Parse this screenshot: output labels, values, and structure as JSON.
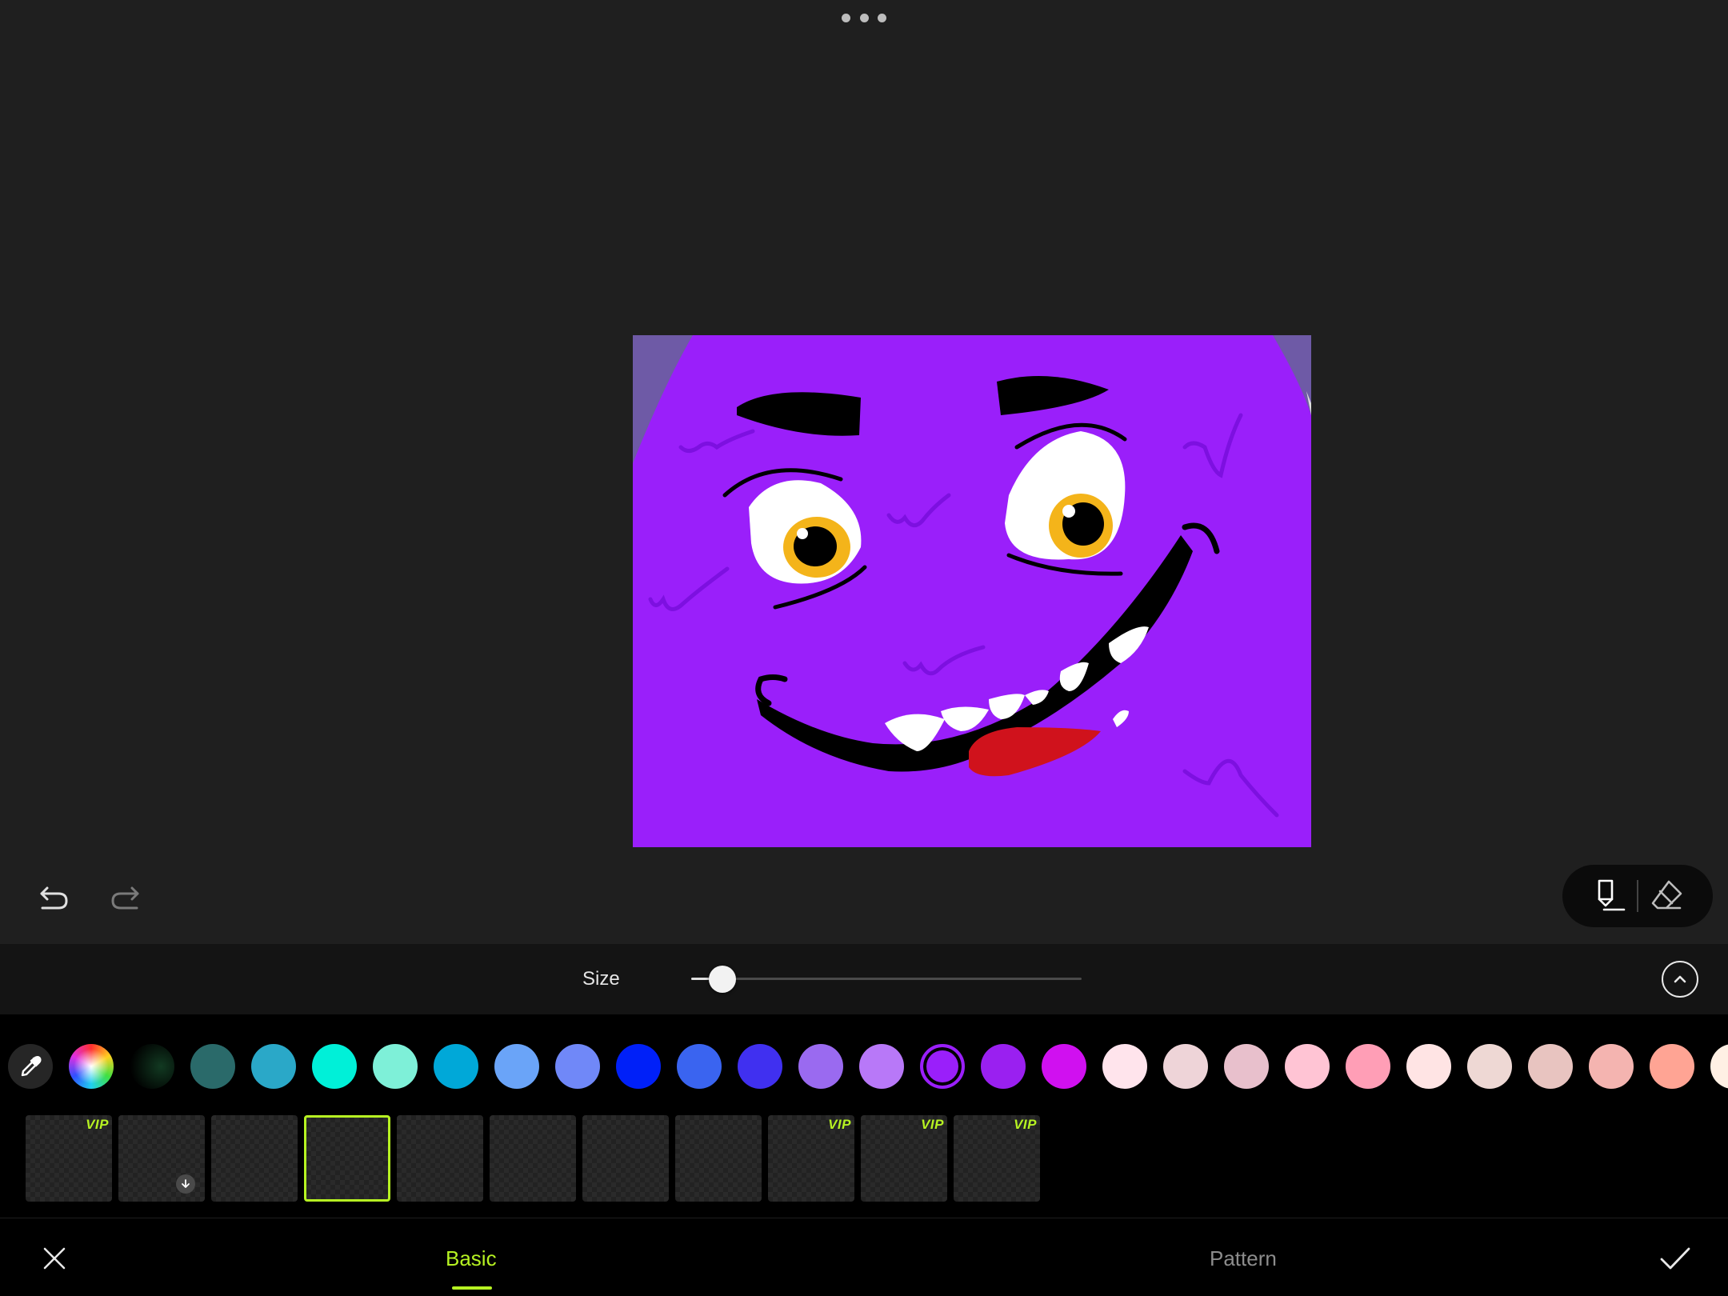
{
  "toolbar": {
    "more_icon": "more-horizontal-icon",
    "undo_icon": "undo-icon",
    "redo_icon": "redo-icon",
    "brush_icon": "brush-icon",
    "eraser_icon": "eraser-icon"
  },
  "size": {
    "label": "Size",
    "value_fraction": 0.08,
    "expand_icon": "chevron-up-icon"
  },
  "palette": {
    "eyedropper_icon": "eyedropper-icon",
    "selected_color": "#9a1ffa",
    "colors": [
      "conic-rainbow",
      "#0a2a1a",
      "#2a6a6a",
      "#2aa8c8",
      "#00f0d8",
      "#7ef0d8",
      "#00a8d8",
      "#6aa4f8",
      "#7088f8",
      "#0020f8",
      "#3a64f0",
      "#4030f0",
      "#9a6af0",
      "#b878f8",
      "#9a1ffa",
      "#9a20f0",
      "#d010f0",
      "#ffe4ec",
      "#eed4d8",
      "#e8c0cc",
      "#ffc4d4",
      "#ff9eb6",
      "#ffe4e4",
      "#eed8d4",
      "#e8c4c0",
      "#f4b4b0",
      "#ffa494",
      "#fff0e4"
    ]
  },
  "brushes": [
    {
      "badge": "VIP",
      "download": false,
      "selected": false
    },
    {
      "badge": "",
      "download": true,
      "selected": false
    },
    {
      "badge": "",
      "download": false,
      "selected": false
    },
    {
      "badge": "",
      "download": false,
      "selected": true
    },
    {
      "badge": "",
      "download": false,
      "selected": false
    },
    {
      "badge": "",
      "download": false,
      "selected": false
    },
    {
      "badge": "",
      "download": false,
      "selected": false
    },
    {
      "badge": "",
      "download": false,
      "selected": false
    },
    {
      "badge": "VIP",
      "download": false,
      "selected": false
    },
    {
      "badge": "VIP",
      "download": false,
      "selected": false
    },
    {
      "badge": "VIP",
      "download": false,
      "selected": false
    }
  ],
  "bottom": {
    "close_icon": "close-icon",
    "confirm_icon": "check-icon",
    "tabs": [
      {
        "label": "Basic",
        "active": true
      },
      {
        "label": "Pattern",
        "active": false
      }
    ]
  },
  "colors": {
    "accent": "#b6f222",
    "canvas_fill": "#9a1ffa"
  }
}
